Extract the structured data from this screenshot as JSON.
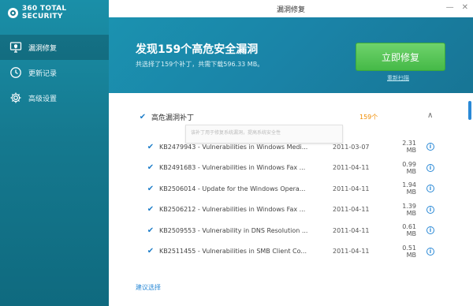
{
  "app": {
    "brand": "360 TOTAL SECURITY"
  },
  "sidebar": {
    "items": [
      {
        "label": "漏洞修复",
        "icon": "monitor-shield-icon"
      },
      {
        "label": "更新记录",
        "icon": "clock-icon"
      },
      {
        "label": "高级设置",
        "icon": "gear-icon"
      }
    ]
  },
  "window": {
    "title": "漏洞修复",
    "minimize": "—",
    "close": "✕"
  },
  "hero": {
    "title": "发现159个高危安全漏洞",
    "subtitle": "共选择了159个补丁，共需下载596.33 MB。",
    "fix_button": "立即修复",
    "rescan_link": "重新扫描"
  },
  "group": {
    "label": "高危漏洞补丁",
    "count": "159个",
    "collapse_glyph": "∧",
    "tooltip": "该补丁用于修复系统漏洞，提高系统安全性"
  },
  "patches": [
    {
      "name": "KB2479943 - Vulnerabilities in Windows Medi...",
      "date": "2011-03-07",
      "size": "2.31 MB"
    },
    {
      "name": "KB2491683 - Vulnerabilities in Windows Fax ...",
      "date": "2011-04-11",
      "size": "0.99 MB"
    },
    {
      "name": "KB2506014 - Update for the Windows Opera...",
      "date": "2011-04-11",
      "size": "1.94 MB"
    },
    {
      "name": "KB2506212 - Vulnerabilities in Windows Fax ...",
      "date": "2011-04-11",
      "size": "1.39 MB"
    },
    {
      "name": "KB2509553 - Vulnerability in DNS Resolution ...",
      "date": "2011-04-11",
      "size": "0.61 MB"
    },
    {
      "name": "KB2511455 - Vulnerabilities in SMB Client Co...",
      "date": "2011-04-11",
      "size": "0.51 MB"
    }
  ],
  "footer": {
    "suggest_link": "建议选择"
  },
  "colors": {
    "accent": "#1a83a7",
    "fix_green": "#45b947",
    "count_orange": "#f08c00",
    "link_blue": "#2a89d6"
  }
}
